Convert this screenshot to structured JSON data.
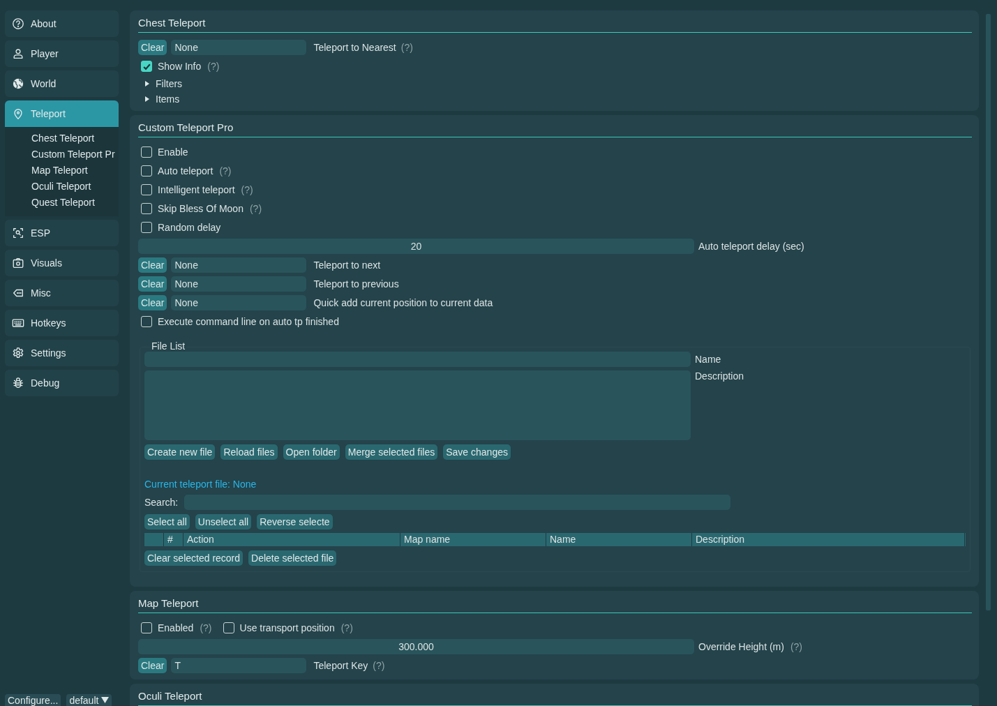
{
  "sidebar": {
    "items": [
      {
        "label": "About",
        "selected": false
      },
      {
        "label": "Player",
        "selected": false
      },
      {
        "label": "World",
        "selected": false
      },
      {
        "label": "Teleport",
        "selected": true,
        "children": [
          {
            "label": "Chest Teleport"
          },
          {
            "label": "Custom Teleport Pr"
          },
          {
            "label": "Map Teleport"
          },
          {
            "label": "Oculi Teleport"
          },
          {
            "label": "Quest Teleport"
          }
        ]
      },
      {
        "label": "ESP",
        "selected": false
      },
      {
        "label": "Visuals",
        "selected": false
      },
      {
        "label": "Misc",
        "selected": false
      },
      {
        "label": "Hotkeys",
        "selected": false
      },
      {
        "label": "Settings",
        "selected": false
      },
      {
        "label": "Debug",
        "selected": false
      }
    ],
    "footer": {
      "configure_button": "Configure...",
      "profile": "default"
    }
  },
  "sections": [
    {
      "title": "Chest Teleport",
      "rows": [
        {
          "kind": "hotkey",
          "button": "Clear",
          "binding": "None",
          "label": "Teleport to Nearest",
          "help": "(?)"
        },
        {
          "kind": "checkbox",
          "label": "Show Info",
          "help": "(?)",
          "checked": true
        },
        {
          "kind": "tree",
          "label": "Filters",
          "expanded": false
        },
        {
          "kind": "tree",
          "label": "Items",
          "expanded": false
        }
      ]
    },
    {
      "title": "Custom Teleport Pro",
      "rows": [
        {
          "kind": "checkbox",
          "label": "Enable",
          "checked": false
        },
        {
          "kind": "checkbox",
          "label": "Auto teleport",
          "help": "(?)",
          "checked": false
        },
        {
          "kind": "checkbox",
          "label": "Intelligent teleport",
          "help": "(?)",
          "checked": false
        },
        {
          "kind": "checkbox",
          "label": "Skip Bless Of Moon",
          "help": "(?)",
          "checked": false
        },
        {
          "kind": "checkbox",
          "label": "Random delay",
          "checked": false
        },
        {
          "kind": "number",
          "value": "20",
          "label": "Auto teleport delay (sec)"
        },
        {
          "kind": "hotkey",
          "button": "Clear",
          "binding": "None",
          "label": "Teleport to next"
        },
        {
          "kind": "hotkey",
          "button": "Clear",
          "binding": "None",
          "label": "Teleport to previous"
        },
        {
          "kind": "hotkey",
          "button": "Clear",
          "binding": "None",
          "label": "Quick add current position to current data"
        },
        {
          "kind": "checkbox",
          "label": "Execute command line on auto tp finished",
          "checked": false
        },
        {
          "kind": "filelist",
          "title": "File List",
          "name_label": "Name",
          "description_label": "Description",
          "file_buttons": [
            "Create new file",
            "Reload files",
            "Open folder",
            "Merge selected files",
            "Save changes"
          ],
          "current_file": "Current teleport file: None",
          "search_label": "Search:",
          "select_buttons": [
            "Select all",
            "Unselect all",
            "Reverse selecte"
          ],
          "columns": [
            "#",
            "Action",
            "Map name",
            "Name",
            "Description"
          ],
          "record_buttons": [
            "Clear selected record",
            "Delete selected file"
          ]
        }
      ]
    },
    {
      "title": "Map Teleport",
      "rows": [
        {
          "kind": "checkboxes",
          "items": [
            {
              "label": "Enabled",
              "help": "(?)",
              "checked": false
            },
            {
              "label": "Use transport position",
              "help": "(?)",
              "checked": false
            }
          ]
        },
        {
          "kind": "number",
          "value": "300.000",
          "label": "Override Height (m)",
          "help": "(?)"
        },
        {
          "kind": "hotkey",
          "button": "Clear",
          "binding": "T",
          "label": "Teleport Key",
          "help": "(?)"
        }
      ]
    },
    {
      "title": "Oculi Teleport"
    }
  ]
}
